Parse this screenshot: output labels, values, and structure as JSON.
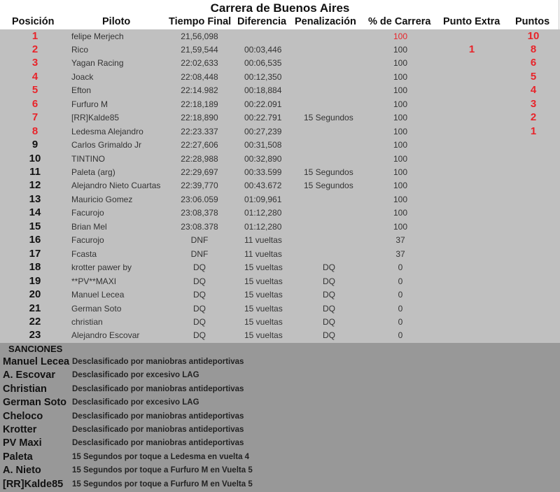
{
  "title": "Carrera de Buenos Aires",
  "colors": {
    "accent_red": "#e8242a",
    "table_bg": "#c0c0c0",
    "sanctions_bg": "#989898"
  },
  "headers": {
    "position": "Posición",
    "pilot": "Piloto",
    "final_time": "Tiempo Final",
    "difference": "Diferencia",
    "penalty": "Penalización",
    "race_pct": "% de Carrera",
    "extra_point": "Punto Extra",
    "points": "Puntos"
  },
  "rows": [
    {
      "pos": "1",
      "pilot": "felipe Merjech",
      "time": "21,56,098",
      "diff": "",
      "penalty": "",
      "pct": "100",
      "extra": "",
      "points": "10"
    },
    {
      "pos": "2",
      "pilot": "Rico",
      "time": "21,59,544",
      "diff": "00:03,446",
      "penalty": "",
      "pct": "100",
      "extra": "1",
      "points": "8"
    },
    {
      "pos": "3",
      "pilot": "Yagan Racing",
      "time": "22:02,633",
      "diff": "00:06,535",
      "penalty": "",
      "pct": "100",
      "extra": "",
      "points": "6"
    },
    {
      "pos": "4",
      "pilot": "Joack",
      "time": "22:08,448",
      "diff": "00:12,350",
      "penalty": "",
      "pct": "100",
      "extra": "",
      "points": "5"
    },
    {
      "pos": "5",
      "pilot": "Efton",
      "time": "22:14.982",
      "diff": "00:18,884",
      "penalty": "",
      "pct": "100",
      "extra": "",
      "points": "4"
    },
    {
      "pos": "6",
      "pilot": "Furfuro M",
      "time": "22:18,189",
      "diff": "00:22.091",
      "penalty": "",
      "pct": "100",
      "extra": "",
      "points": "3"
    },
    {
      "pos": "7",
      "pilot": "[RR]Kalde85",
      "time": "22:18,890",
      "diff": "00:22.791",
      "penalty": "15 Segundos",
      "pct": "100",
      "extra": "",
      "points": "2"
    },
    {
      "pos": "8",
      "pilot": "Ledesma Alejandro",
      "time": "22:23.337",
      "diff": "00:27,239",
      "penalty": "",
      "pct": "100",
      "extra": "",
      "points": "1"
    },
    {
      "pos": "9",
      "pilot": "Carlos Grimaldo Jr",
      "time": "22:27,606",
      "diff": "00:31,508",
      "penalty": "",
      "pct": "100",
      "extra": "",
      "points": ""
    },
    {
      "pos": "10",
      "pilot": "TINTINO",
      "time": "22:28,988",
      "diff": "00:32,890",
      "penalty": "",
      "pct": "100",
      "extra": "",
      "points": ""
    },
    {
      "pos": "11",
      "pilot": "Paleta (arg)",
      "time": "22:29,697",
      "diff": "00:33.599",
      "penalty": "15 Segundos",
      "pct": "100",
      "extra": "",
      "points": ""
    },
    {
      "pos": "12",
      "pilot": "Alejandro Nieto Cuartas",
      "time": "22:39,770",
      "diff": "00:43.672",
      "penalty": "15 Segundos",
      "pct": "100",
      "extra": "",
      "points": ""
    },
    {
      "pos": "13",
      "pilot": "Mauricio Gomez",
      "time": "23:06.059",
      "diff": "01:09,961",
      "penalty": "",
      "pct": "100",
      "extra": "",
      "points": ""
    },
    {
      "pos": "14",
      "pilot": "Facurojo",
      "time": "23:08,378",
      "diff": "01:12,280",
      "penalty": "",
      "pct": "100",
      "extra": "",
      "points": ""
    },
    {
      "pos": "15",
      "pilot": "Brian Mel",
      "time": "23:08.378",
      "diff": "01:12,280",
      "penalty": "",
      "pct": "100",
      "extra": "",
      "points": ""
    },
    {
      "pos": "16",
      "pilot": "Facurojo",
      "time": "DNF",
      "diff": "11 vueltas",
      "penalty": "",
      "pct": "37",
      "extra": "",
      "points": ""
    },
    {
      "pos": "17",
      "pilot": "Fcasta",
      "time": "DNF",
      "diff": "11 vueltas",
      "penalty": "",
      "pct": "37",
      "extra": "",
      "points": ""
    },
    {
      "pos": "18",
      "pilot": "krotter pawer by",
      "time": "DQ",
      "diff": "15 vueltas",
      "penalty": "DQ",
      "pct": "0",
      "extra": "",
      "points": ""
    },
    {
      "pos": "19",
      "pilot": "**PV**MAXI",
      "time": "DQ",
      "diff": "15 vueltas",
      "penalty": "DQ",
      "pct": "0",
      "extra": "",
      "points": ""
    },
    {
      "pos": "20",
      "pilot": "Manuel Lecea",
      "time": "DQ",
      "diff": "15 vueltas",
      "penalty": "DQ",
      "pct": "0",
      "extra": "",
      "points": ""
    },
    {
      "pos": "21",
      "pilot": "German Soto",
      "time": "DQ",
      "diff": "15 vueltas",
      "penalty": "DQ",
      "pct": "0",
      "extra": "",
      "points": ""
    },
    {
      "pos": "22",
      "pilot": "christian",
      "time": "DQ",
      "diff": "15 vueltas",
      "penalty": "DQ",
      "pct": "0",
      "extra": "",
      "points": ""
    },
    {
      "pos": "23",
      "pilot": "Alejandro Escovar",
      "time": "DQ",
      "diff": "15 vueltas",
      "penalty": "DQ",
      "pct": "0",
      "extra": "",
      "points": ""
    }
  ],
  "sanctions": {
    "title": "SANCIONES",
    "items": [
      {
        "name": "Manuel Lecea",
        "desc": "Desclasificado por maniobras antideportivas"
      },
      {
        "name": "A. Escovar",
        "desc": "Desclasificado por excesivo LAG"
      },
      {
        "name": "Christian",
        "desc": "Desclasificado por maniobras antideportivas"
      },
      {
        "name": "German Soto",
        "desc": "Desclasificado por excesivo LAG"
      },
      {
        "name": "Cheloco",
        "desc": "Desclasificado por maniobras antideportivas"
      },
      {
        "name": "Krotter",
        "desc": "Desclasificado por maniobras antideportivas"
      },
      {
        "name": "PV Maxi",
        "desc": "Desclasificado por maniobras antideportivas"
      },
      {
        "name": "Paleta",
        "desc": "15 Segundos por toque a Ledesma en vuelta 4"
      },
      {
        "name": "A. Nieto",
        "desc": "15 Segundos por toque a Furfuro M en Vuelta 5"
      },
      {
        "name": "[RR]Kalde85",
        "desc": "15 Segundos por toque a Furfuro M en Vuelta 5"
      }
    ]
  }
}
